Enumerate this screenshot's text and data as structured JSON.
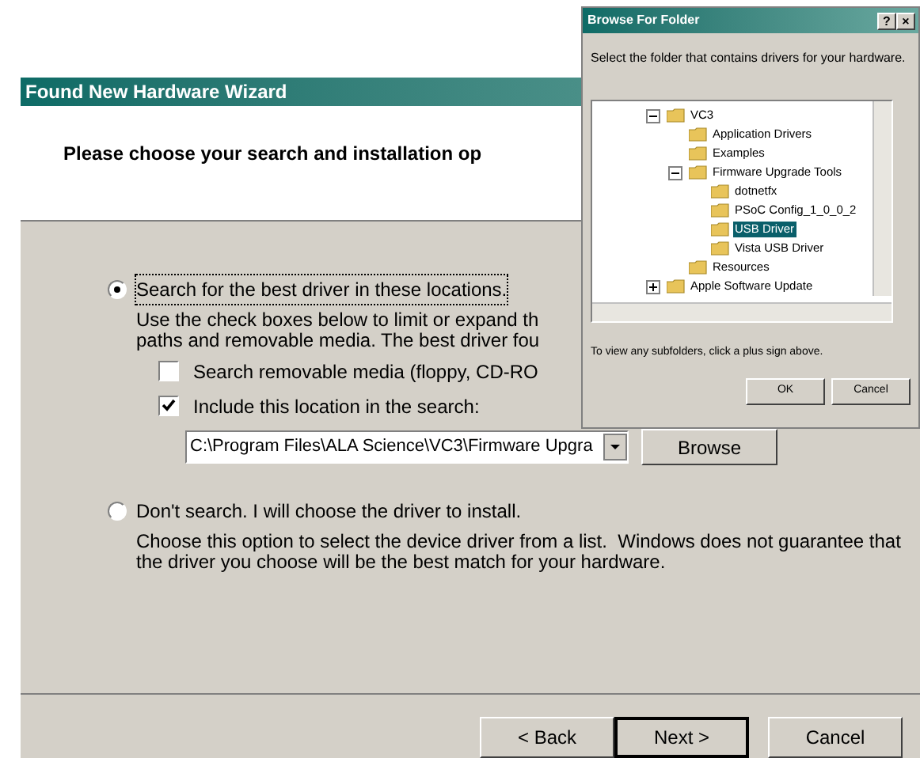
{
  "wizard": {
    "title": "Found New Hardware Wizard",
    "heading": "Please choose your search and installation op",
    "options": [
      {
        "label": "Search for the best driver in these locations.",
        "selected": true,
        "description": "Use the check boxes below to limit or expand th\npaths and removable media. The best driver fou",
        "checkboxes": [
          {
            "label": "Search removable media (floppy, CD-RO",
            "checked": false
          },
          {
            "label": "Include this location in the search:",
            "checked": true
          }
        ],
        "location": {
          "value": "C:\\Program Files\\ALA Science\\VC3\\Firmware Upgra",
          "button": "Browse"
        }
      },
      {
        "label": "Don't search. I will choose the driver to install.",
        "selected": false,
        "description": "Choose this option to select the device driver from a list.  Windows does not guarantee that\nthe driver you choose will be the best match for your hardware."
      }
    ],
    "buttons": [
      {
        "label": "< Back",
        "default": false
      },
      {
        "label": "Next >",
        "default": true
      },
      {
        "label": "Cancel",
        "default": false
      }
    ]
  },
  "browse_dialog": {
    "title": "Browse For Folder",
    "title_buttons": [
      "?",
      "×"
    ],
    "instruction": "Select the folder that contains drivers for your hardware.",
    "tree": [
      {
        "label": "VC3",
        "selected": false,
        "expanded": true,
        "children": [
          {
            "label": "Application Drivers",
            "selected": false
          },
          {
            "label": "Examples",
            "selected": false
          },
          {
            "label": "Firmware Upgrade Tools",
            "selected": false,
            "expanded": true,
            "children": [
              {
                "label": "dotnetfx",
                "selected": false
              },
              {
                "label": "PSoC Config_1_0_0_2",
                "selected": false
              },
              {
                "label": "USB Driver",
                "selected": true
              },
              {
                "label": "Vista USB Driver",
                "selected": false
              }
            ]
          },
          {
            "label": "Resources",
            "selected": false
          }
        ]
      },
      {
        "label": "Apple Software Update",
        "selected": false,
        "expanded": false
      }
    ],
    "hint": "To view any subfolders, click a plus sign above.",
    "buttons": [
      "OK",
      "Cancel"
    ]
  }
}
